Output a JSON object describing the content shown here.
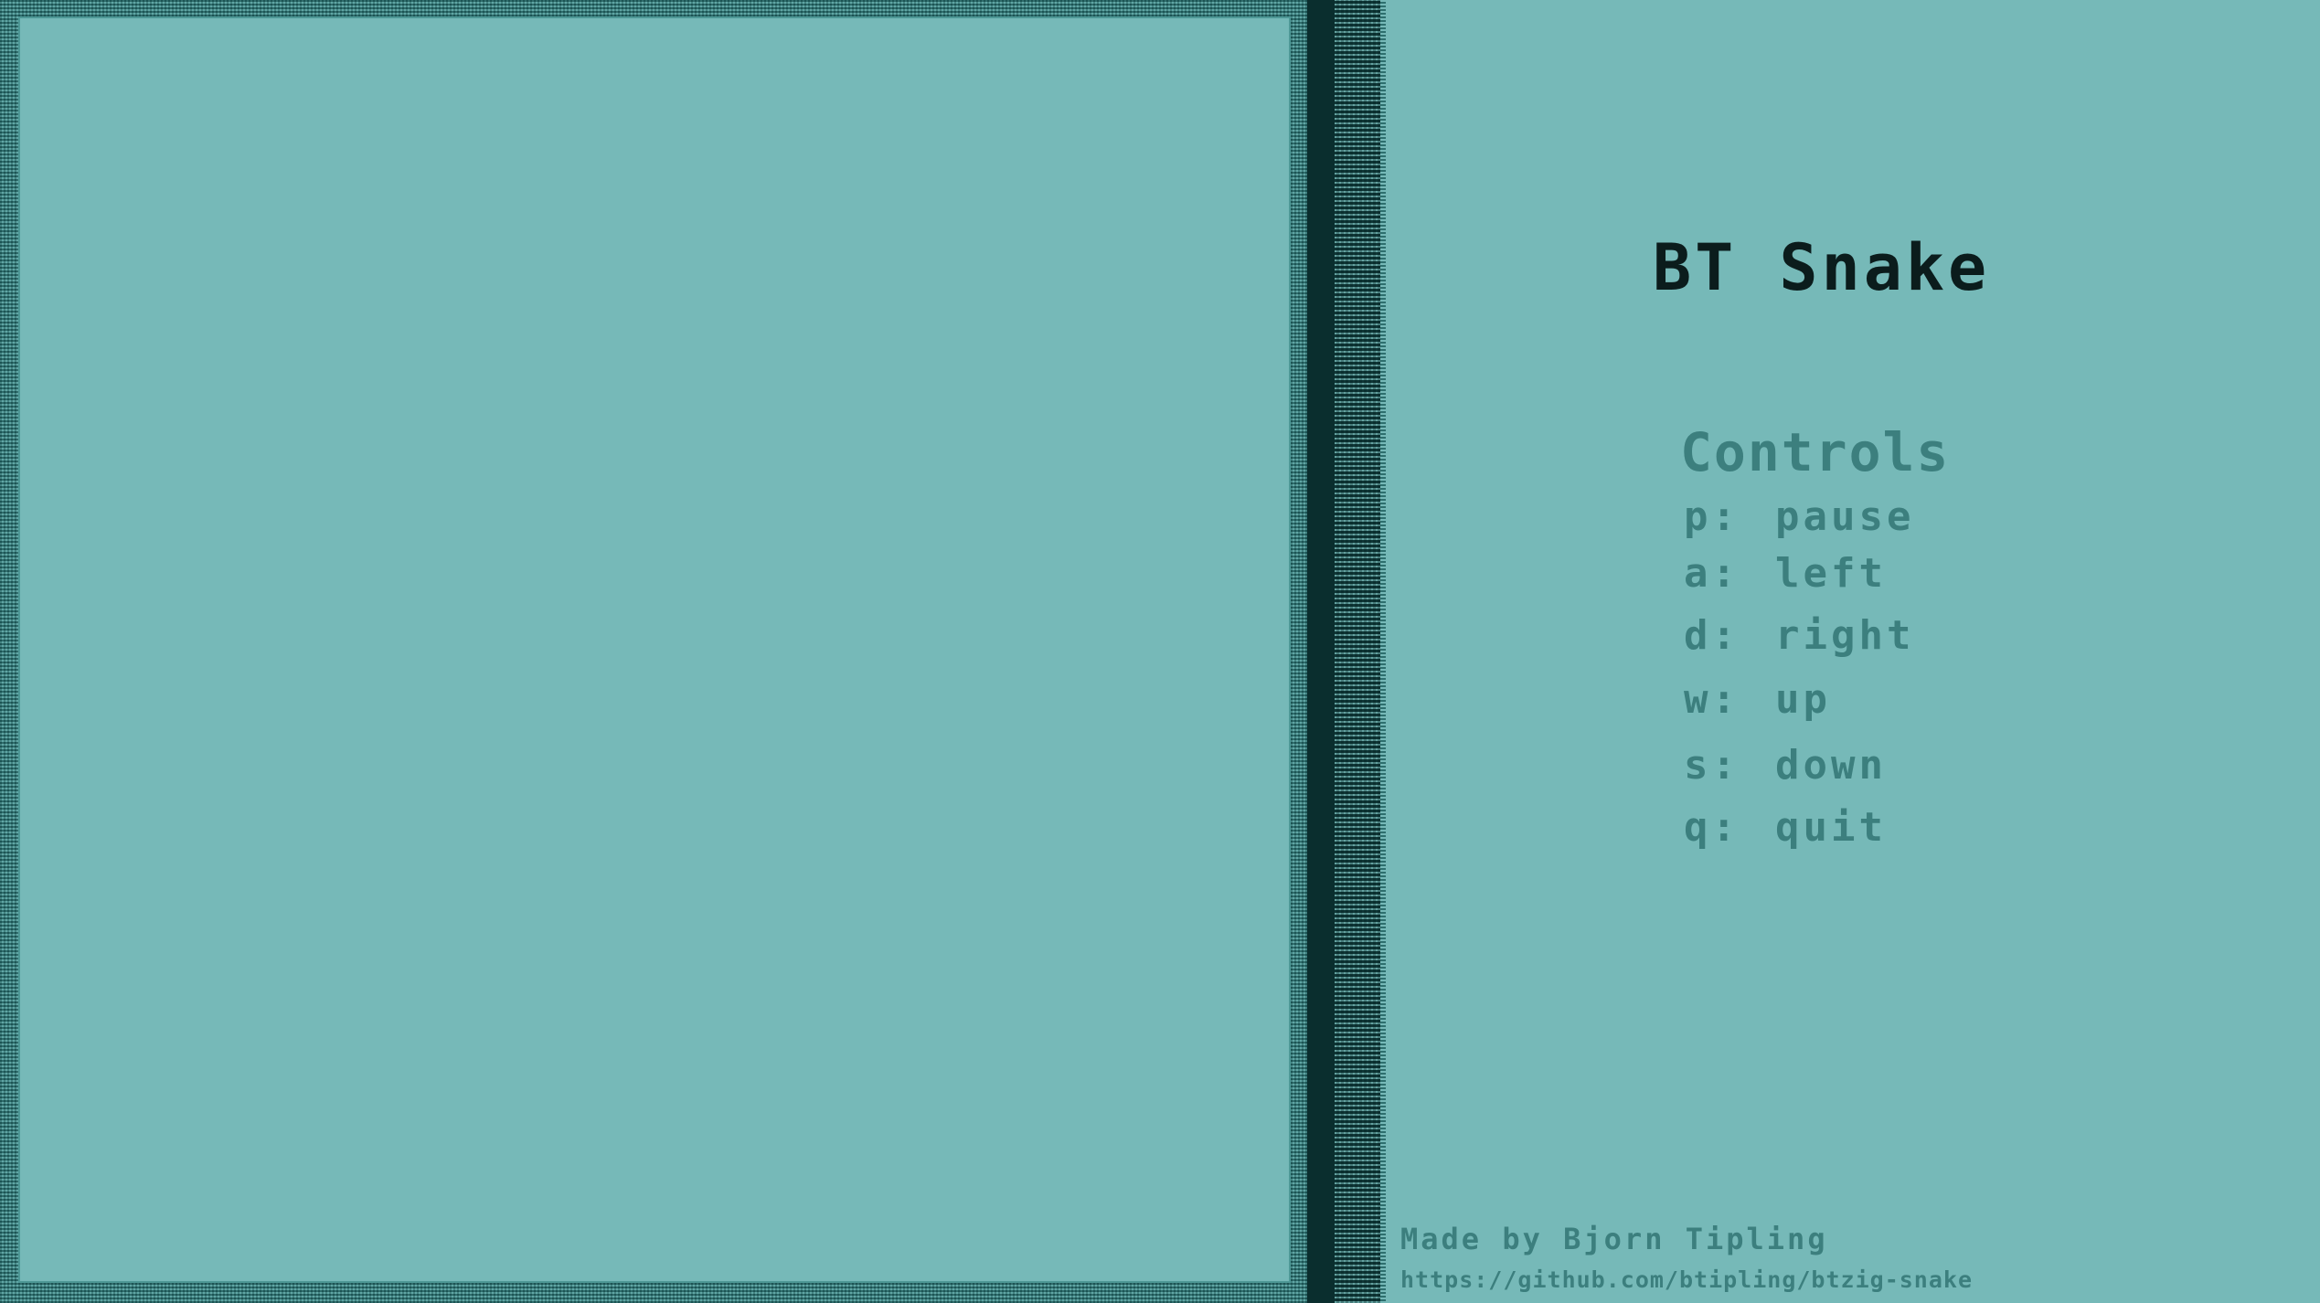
{
  "theme": {
    "background": "#76b9b8",
    "text_dark": "#0b1c1c",
    "text_muted": "#3c7f7e",
    "border_dark": "#0a2e2e"
  },
  "panel": {
    "title": "BT Snake",
    "controls_heading": "Controls",
    "controls": [
      {
        "key": "p:",
        "action": "pause"
      },
      {
        "key": "a:",
        "action": "left"
      },
      {
        "key": "d:",
        "action": "right"
      },
      {
        "key": "w:",
        "action": "up"
      },
      {
        "key": "s:",
        "action": "down"
      },
      {
        "key": "q:",
        "action": "quit"
      }
    ],
    "credit_author": "Made by Bjorn Tipling",
    "credit_url": "https://github.com/btipling/btzig-snake"
  }
}
